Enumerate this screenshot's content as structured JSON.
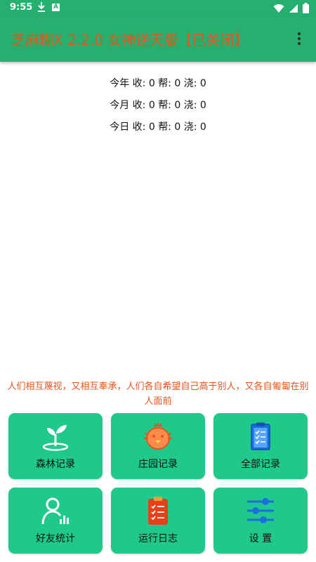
{
  "status_bar": {
    "time": "9:55",
    "a_glyph": "A"
  },
  "app_bar": {
    "title": "芝麻糊X 2.2.0 女神逆天版【已关闭】"
  },
  "stats": [
    {
      "label": "今年",
      "shou": "收: 0",
      "bang": "帮: 0",
      "jiao": "浇: 0"
    },
    {
      "label": "今月",
      "shou": "收: 0",
      "bang": "帮: 0",
      "jiao": "浇: 0"
    },
    {
      "label": "今日",
      "shou": "收: 0",
      "bang": "帮: 0",
      "jiao": "浇: 0"
    }
  ],
  "quote": "人们相互蔑视，又相互奉承，人们各自希望自己高于别人，又各自匍匐在别人面前",
  "tiles": [
    {
      "label": "森林记录",
      "icon": "sprout-icon"
    },
    {
      "label": "庄园记录",
      "icon": "chicken-icon"
    },
    {
      "label": "全部记录",
      "icon": "clipboard-icon"
    },
    {
      "label": "好友统计",
      "icon": "user-stats-icon"
    },
    {
      "label": "运行日志",
      "icon": "log-clipboard-icon"
    },
    {
      "label": "设 置",
      "icon": "sliders-icon"
    }
  ],
  "colors": {
    "primary": "#26b070",
    "tile": "#1ec98b",
    "accent": "#e8531c"
  }
}
